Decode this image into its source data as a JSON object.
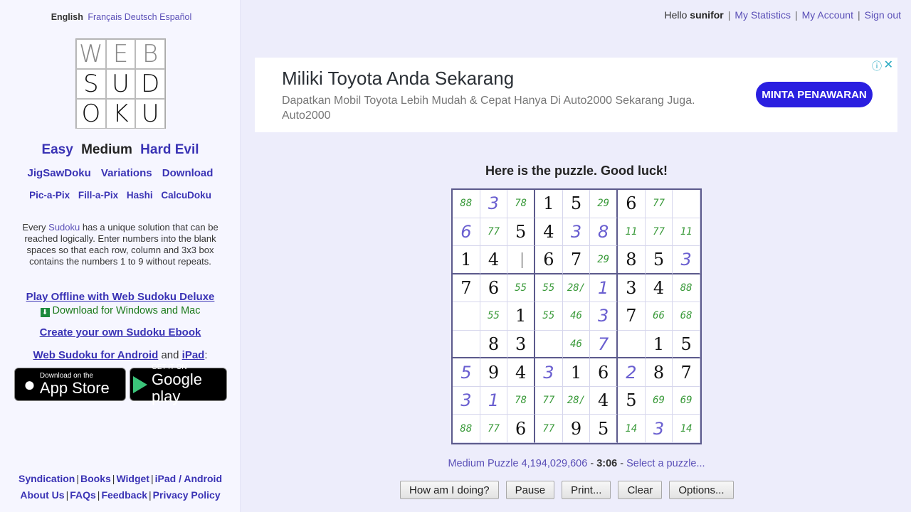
{
  "languages": [
    {
      "label": "English",
      "current": true
    },
    {
      "label": "Français",
      "current": false
    },
    {
      "label": "Deutsch",
      "current": false
    },
    {
      "label": "Español",
      "current": false
    }
  ],
  "logo": {
    "letters": [
      "W",
      "E",
      "B",
      "S",
      "U",
      "D",
      "O",
      "K",
      "U"
    ]
  },
  "levels": [
    {
      "label": "Easy",
      "current": false
    },
    {
      "label": "Medium",
      "current": true
    },
    {
      "label": "Hard",
      "current": false
    },
    {
      "label": "Evil",
      "current": false
    }
  ],
  "nav_primary": [
    "JigSawDoku",
    "Variations",
    "Download"
  ],
  "nav_secondary": [
    "Pic-a-Pix",
    "Fill-a-Pix",
    "Hashi",
    "CalcuDoku"
  ],
  "description": {
    "prefix": "Every ",
    "link": "Sudoku",
    "suffix": " has a unique solution that can be reached logically. Enter numbers into the blank spaces so that each row, column and 3x3 box contains the numbers 1 to 9 without repeats."
  },
  "promo": {
    "offline_link": "Play Offline with Web Sudoku Deluxe",
    "download_text": "Download for Windows and Mac",
    "ebook_link": "Create your own Sudoku Ebook",
    "android_link": "Web Sudoku for Android",
    "and_text": " and ",
    "ipad_link": "iPad",
    "colon": ":",
    "app_store_small": "Download on the",
    "app_store_big": "App Store",
    "google_small": "GET IT ON",
    "google_big": "Google play"
  },
  "footer": {
    "row1": [
      "Syndication",
      "Books",
      "Widget",
      "iPad / Android"
    ],
    "row2": [
      "About Us",
      "FAQs",
      "Feedback",
      "Privacy Policy"
    ]
  },
  "userbar": {
    "hello": "Hello ",
    "username": "sunifor",
    "links": [
      "My Statistics",
      "My Account",
      "Sign out"
    ]
  },
  "ad": {
    "title": "Miliki Toyota Anda Sekarang",
    "subtitle": "Dapatkan Mobil Toyota Lebih Mudah & Cepat Hanya Di Auto2000 Sekarang Juga. Auto2000",
    "button": "MINTA PENAWARAN",
    "info_icon": "ⓘ",
    "close_icon": "✕"
  },
  "puzzle": {
    "heading": "Here is the puzzle. Good luck!",
    "cells": [
      [
        {
          "v": "88",
          "t": "note"
        },
        {
          "v": "3",
          "t": "user"
        },
        {
          "v": "78",
          "t": "note"
        },
        {
          "v": "1",
          "t": "given"
        },
        {
          "v": "5",
          "t": "given"
        },
        {
          "v": "29",
          "t": "note"
        },
        {
          "v": "6",
          "t": "given"
        },
        {
          "v": "77",
          "t": "note"
        },
        {
          "v": "",
          "t": "empty"
        }
      ],
      [
        {
          "v": "6",
          "t": "user"
        },
        {
          "v": "77",
          "t": "note"
        },
        {
          "v": "5",
          "t": "given"
        },
        {
          "v": "4",
          "t": "given"
        },
        {
          "v": "3",
          "t": "user"
        },
        {
          "v": "8",
          "t": "user"
        },
        {
          "v": "11",
          "t": "note"
        },
        {
          "v": "77",
          "t": "note"
        },
        {
          "v": "11",
          "t": "note"
        }
      ],
      [
        {
          "v": "1",
          "t": "given"
        },
        {
          "v": "4",
          "t": "given"
        },
        {
          "v": "",
          "t": "active"
        },
        {
          "v": "6",
          "t": "given"
        },
        {
          "v": "7",
          "t": "given"
        },
        {
          "v": "29",
          "t": "note"
        },
        {
          "v": "8",
          "t": "given"
        },
        {
          "v": "5",
          "t": "given"
        },
        {
          "v": "3",
          "t": "user"
        }
      ],
      [
        {
          "v": "7",
          "t": "given"
        },
        {
          "v": "6",
          "t": "given"
        },
        {
          "v": "55",
          "t": "note"
        },
        {
          "v": "55",
          "t": "note"
        },
        {
          "v": "28/",
          "t": "note"
        },
        {
          "v": "1",
          "t": "user"
        },
        {
          "v": "3",
          "t": "given"
        },
        {
          "v": "4",
          "t": "given"
        },
        {
          "v": "88",
          "t": "note"
        }
      ],
      [
        {
          "v": "",
          "t": "empty"
        },
        {
          "v": "55",
          "t": "note"
        },
        {
          "v": "1",
          "t": "given"
        },
        {
          "v": "55",
          "t": "note"
        },
        {
          "v": "46",
          "t": "note"
        },
        {
          "v": "3",
          "t": "user"
        },
        {
          "v": "7",
          "t": "given"
        },
        {
          "v": "66",
          "t": "note"
        },
        {
          "v": "68",
          "t": "note"
        }
      ],
      [
        {
          "v": "",
          "t": "empty"
        },
        {
          "v": "8",
          "t": "given"
        },
        {
          "v": "3",
          "t": "given"
        },
        {
          "v": "",
          "t": "empty"
        },
        {
          "v": "46",
          "t": "note"
        },
        {
          "v": "7",
          "t": "user"
        },
        {
          "v": "",
          "t": "empty"
        },
        {
          "v": "1",
          "t": "given"
        },
        {
          "v": "5",
          "t": "given"
        }
      ],
      [
        {
          "v": "5",
          "t": "user"
        },
        {
          "v": "9",
          "t": "given"
        },
        {
          "v": "4",
          "t": "given"
        },
        {
          "v": "3",
          "t": "user"
        },
        {
          "v": "1",
          "t": "given"
        },
        {
          "v": "6",
          "t": "given"
        },
        {
          "v": "2",
          "t": "user"
        },
        {
          "v": "8",
          "t": "given"
        },
        {
          "v": "7",
          "t": "given"
        }
      ],
      [
        {
          "v": "3",
          "t": "user"
        },
        {
          "v": "1",
          "t": "user"
        },
        {
          "v": "78",
          "t": "note"
        },
        {
          "v": "77",
          "t": "note"
        },
        {
          "v": "28/",
          "t": "note"
        },
        {
          "v": "4",
          "t": "given"
        },
        {
          "v": "5",
          "t": "given"
        },
        {
          "v": "69",
          "t": "note"
        },
        {
          "v": "69",
          "t": "note"
        }
      ],
      [
        {
          "v": "88",
          "t": "note"
        },
        {
          "v": "77",
          "t": "note"
        },
        {
          "v": "6",
          "t": "given"
        },
        {
          "v": "77",
          "t": "note"
        },
        {
          "v": "9",
          "t": "given"
        },
        {
          "v": "5",
          "t": "given"
        },
        {
          "v": "14",
          "t": "note"
        },
        {
          "v": "3",
          "t": "user"
        },
        {
          "v": "14",
          "t": "note"
        }
      ]
    ]
  },
  "status": {
    "puzzle_label": "Medium Puzzle 4,194,029,606",
    "sep1": " - ",
    "timer": "3:06",
    "sep2": " - ",
    "select_link": "Select a puzzle..."
  },
  "buttons": [
    "How am I doing?",
    "Pause",
    "Print...",
    "Clear",
    "Options..."
  ]
}
